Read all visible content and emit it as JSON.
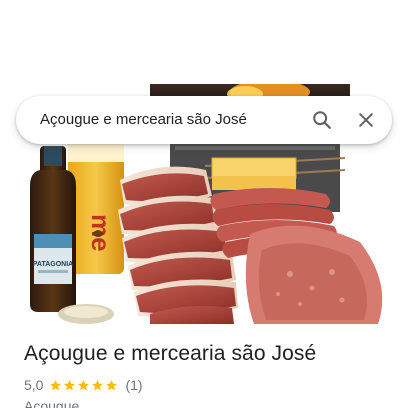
{
  "search": {
    "query": "Açougue e mercearia são José",
    "search_icon": "search-icon",
    "close_icon": "close-icon"
  },
  "photo": {
    "description_icon": "place-photo",
    "bottle_label": "PATAGONIA",
    "can_label": "me"
  },
  "place": {
    "title": "Açougue e mercearia são José",
    "rating": "5,0",
    "stars": 5,
    "review_count": "(1)",
    "category": "Açougue"
  },
  "colors": {
    "star": "#fbbc04",
    "secondary_text": "#70757a",
    "primary_text": "#202124",
    "icon": "#5f6368"
  }
}
